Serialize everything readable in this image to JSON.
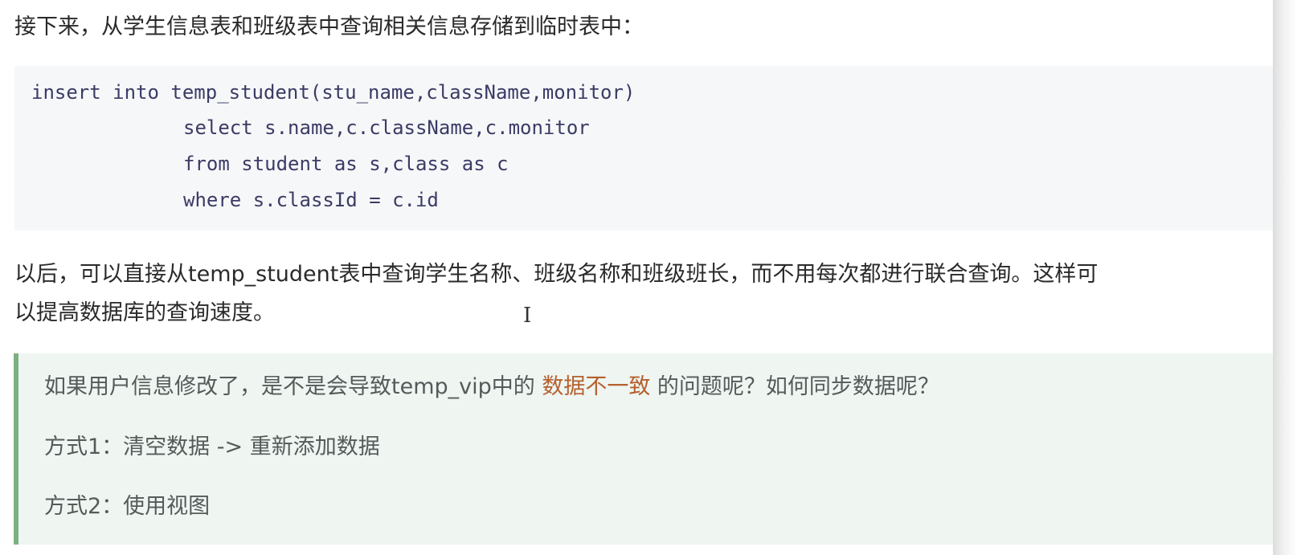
{
  "intro": "接下来，从学生信息表和班级表中查询相关信息存储到临时表中：",
  "code": {
    "line1": "insert into temp_student(stu_name,className,monitor)",
    "line2": "select s.name,c.className,c.monitor",
    "line3": "from student as s,class as c",
    "line4": "where s.classId = c.id"
  },
  "paragraph": {
    "line1": "以后，可以直接从temp_student表中查询学生名称、班级名称和班级班长，而不用每次都进行联合查询。这样可",
    "line2": "以提高数据库的查询速度。"
  },
  "note": {
    "q_before": "如果用户信息修改了，是不是会导致temp_vip中的 ",
    "q_highlight": "数据不一致",
    "q_after": " 的问题呢？如何同步数据呢？",
    "method1": "方式1：清空数据 -> 重新添加数据",
    "method2": "方式2：使用视图"
  },
  "cursor_glyph": "I",
  "colors": {
    "note_border": "#7cb083",
    "note_background": "#eff5f1",
    "highlight_text": "#b5602e",
    "code_background": "#f6f7f8"
  }
}
